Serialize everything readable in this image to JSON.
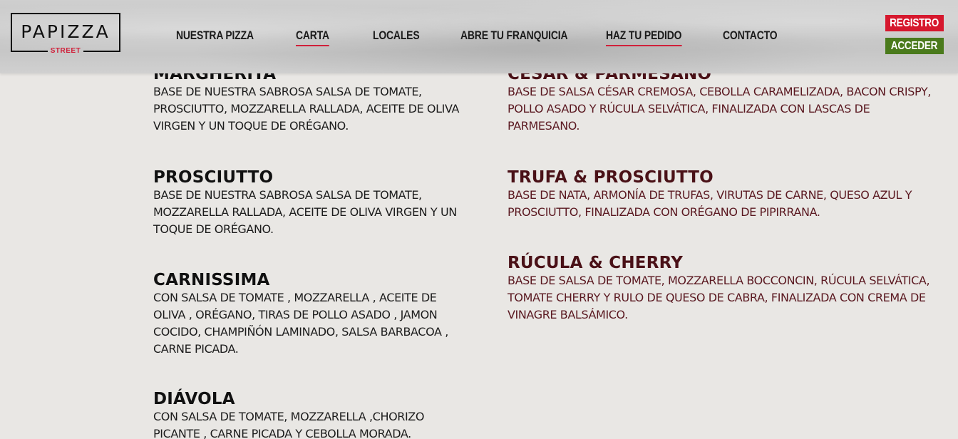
{
  "header": {
    "logo": {
      "title": "PAPIZZA",
      "subtitle": "STREET"
    },
    "nav": [
      {
        "label": "NUESTRA PIZZA",
        "active": false
      },
      {
        "label": "CARTA",
        "active": true
      },
      {
        "label": "LOCALES",
        "active": false
      },
      {
        "label": "ABRE TU FRANQUICIA",
        "active": false
      },
      {
        "label": "HAZ TU PEDIDO",
        "active": true
      },
      {
        "label": "CONTACTO",
        "active": false
      }
    ],
    "registro_label": "REGISTRO",
    "acceder_label": "ACCEDER"
  },
  "menu": {
    "left": [
      {
        "name": "MARGHERITA",
        "description": "BASE DE NUESTRA SABROSA SALSA DE TOMATE, PROSCIUTTO, MOZZARELLA RALLADA, ACEITE DE OLIVA VIRGEN Y UN TOQUE DE ORÉGANO."
      },
      {
        "name": "PROSCIUTTO",
        "description": "BASE DE NUESTRA SABROSA SALSA DE TOMATE, MOZZARELLA RALLADA, ACEITE DE OLIVA VIRGEN Y UN TOQUE DE ORÉGANO."
      },
      {
        "name": "CARNISSIMA",
        "description": "CON SALSA DE TOMATE , MOZZARELLA , ACEITE DE OLIVA , ORÉGANO, TIRAS DE POLLO ASADO , JAMON COCIDO, CHAMPIÑÓN LAMINADO, SALSA BARBACOA , CARNE PICADA."
      },
      {
        "name": "DIÁVOLA",
        "description": "CON SALSA DE TOMATE, MOZZARELLA ,CHORIZO PICANTE , CARNE PICADA Y CEBOLLA MORADA."
      }
    ],
    "right": [
      {
        "name": "CÉSAR & PARMESANO",
        "description": "BASE DE SALSA CÉSAR CREMOSA, CEBOLLA CARAMELIZADA, BACON CRISPY, POLLO ASADO Y RÚCULA SELVÁTICA, FINALIZADA CON LASCAS DE PARMESANO."
      },
      {
        "name": "TRUFA & PROSCIUTTO",
        "description": "BASE DE NATA, ARMONÍA DE TRUFAS, VIRUTAS DE CARNE, QUESO AZUL Y PROSCIUTTO, FINALIZADA CON ORÉGANO DE PIPIRRANA."
      },
      {
        "name": "RÚCULA & CHERRY",
        "description": "BASE DE SALSA DE TOMATE, MOZZARELLA BOCCONCIN, RÚCULA SELVÁTICA, TOMATE CHERRY Y RULO DE QUESO DE CABRA, FINALIZADA CON CREMA DE VINAGRE BALSÁMICO."
      }
    ]
  },
  "colors": {
    "brand_red": "#d6182e",
    "brand_green": "#4a7a1c",
    "right_column_text": "#4a1117",
    "background": "#e9e7e4"
  }
}
